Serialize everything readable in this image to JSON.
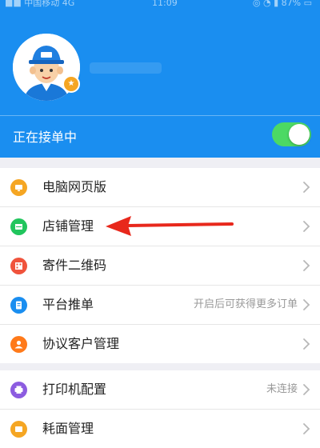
{
  "statusbar": {
    "left": "■■ 中国移动  4G",
    "center": "11:09",
    "right": "◎ ◔ ▮ 87% ▭"
  },
  "status": {
    "label": "正在接单中",
    "toggle_on": true
  },
  "menu_group_1": [
    {
      "label": "电脑网页版",
      "icon": "monitor-icon",
      "color": "#f5a623",
      "hint": ""
    },
    {
      "label": "店铺管理",
      "icon": "shop-icon",
      "color": "#21c55d",
      "hint": ""
    },
    {
      "label": "寄件二维码",
      "icon": "qrcode-icon",
      "color": "#f0533c",
      "hint": ""
    },
    {
      "label": "平台推单",
      "icon": "document-icon",
      "color": "#1a8ef0",
      "hint": "开启后可获得更多订单"
    },
    {
      "label": "协议客户管理",
      "icon": "user-icon",
      "color": "#ff7a1a",
      "hint": ""
    }
  ],
  "menu_group_2": [
    {
      "label": "打印机配置",
      "icon": "printer-icon",
      "color": "#8c5ce0",
      "hint": "未连接"
    },
    {
      "label": "耗面管理",
      "icon": "box-icon",
      "color": "#f5a623",
      "hint": ""
    }
  ],
  "avatar": {
    "badge": "★"
  },
  "colors": {
    "header": "#1a8ef0",
    "toggle": "#4cd964",
    "annotation_arrow": "#e8281c"
  }
}
